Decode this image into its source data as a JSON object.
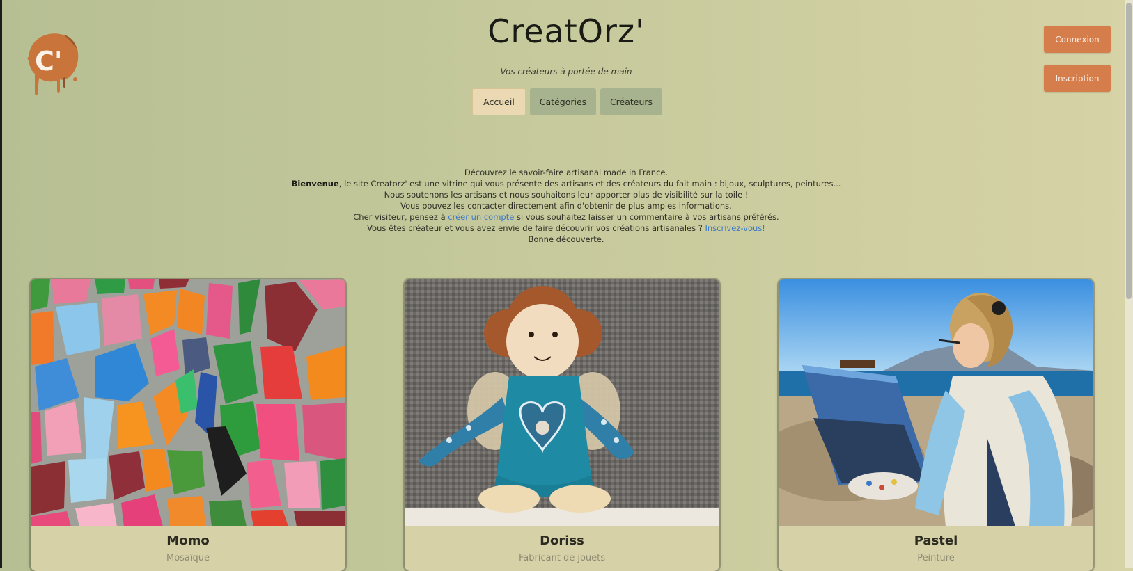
{
  "header": {
    "logo_text": "C'",
    "title": "CreatOrz'",
    "subtitle": "Vos créateurs à portée de main"
  },
  "nav": [
    {
      "label": "Accueil",
      "active": true
    },
    {
      "label": "Catégories",
      "active": false
    },
    {
      "label": "Créateurs",
      "active": false
    }
  ],
  "auth": {
    "login": "Connexion",
    "signup": "Inscription"
  },
  "intro": {
    "line1": "Découvrez le savoir-faire artisanal made in France.",
    "line2_bold": "Bienvenue",
    "line2_rest": ", le site Creatorz' est une vitrine qui vous présente des artisans et des créateurs du fait main : bijoux, sculptures, peintures...",
    "line3": "Nous soutenons les artisans et nous souhaitons leur apporter plus de visibilité sur la toile !",
    "line4": "Vous pouvez les contacter directement afin d'obtenir de plus amples informations.",
    "line5_before": "Cher visiteur, pensez à ",
    "line5_link": "créer un compte",
    "line5_after": " si vous souhaitez laisser un commentaire à vos artisans préférés.",
    "line6_before": "Vous êtes créateur et vous avez envie de faire découvrir vos créations artisanales ? ",
    "line6_link": "Inscrivez-vous!",
    "line7": "Bonne découverte."
  },
  "cards": [
    {
      "name": "Momo",
      "category": "Mosaïque"
    },
    {
      "name": "Doriss",
      "category": "Fabricant de jouets"
    },
    {
      "name": "Pastel",
      "category": "Peinture"
    }
  ],
  "colors": {
    "accent_button": "#d67d4c",
    "nav_active": "#ead9b3",
    "nav_inactive": "#a7b28e",
    "link": "#3a78c8"
  }
}
